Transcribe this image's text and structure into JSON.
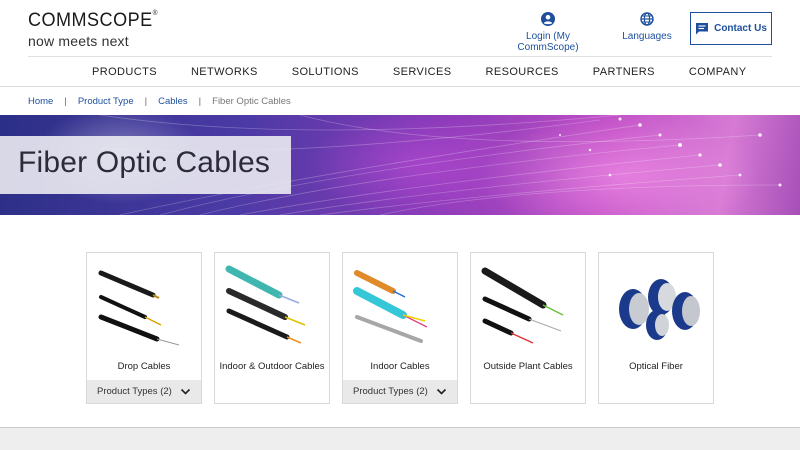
{
  "header": {
    "logo_main": "COMMSCOPE",
    "logo_reg": "®",
    "logo_tagline": "now meets next",
    "login_label": "Login (My CommScope)",
    "languages_label": "Languages",
    "contact_label": "Contact Us"
  },
  "nav": {
    "items": [
      "PRODUCTS",
      "NETWORKS",
      "SOLUTIONS",
      "SERVICES",
      "RESOURCES",
      "PARTNERS",
      "COMPANY"
    ]
  },
  "breadcrumb": {
    "items": [
      "Home",
      "Product Type",
      "Cables"
    ],
    "current": "Fiber Optic Cables",
    "separator": "|"
  },
  "hero": {
    "title": "Fiber Optic Cables"
  },
  "cards": [
    {
      "label": "Drop Cables",
      "types": "Product Types (2)",
      "image": "drop-cables"
    },
    {
      "label": "Indoor & Outdoor Cables",
      "types": null,
      "image": "indoor-outdoor-cables"
    },
    {
      "label": "Indoor Cables",
      "types": "Product Types (2)",
      "image": "indoor-cables"
    },
    {
      "label": "Outside Plant Cables",
      "types": null,
      "image": "outside-plant-cables"
    },
    {
      "label": "Optical Fiber",
      "types": null,
      "image": "optical-fiber-spools"
    }
  ],
  "icons": {
    "login": "user-circle-icon",
    "languages": "globe-icon",
    "contact": "chat-icon",
    "card_expand": "chevron-down-icon"
  },
  "colors": {
    "brand_blue": "#1d4f9e",
    "hero_start": "#2b2f86",
    "hero_end": "#d67ad4"
  }
}
